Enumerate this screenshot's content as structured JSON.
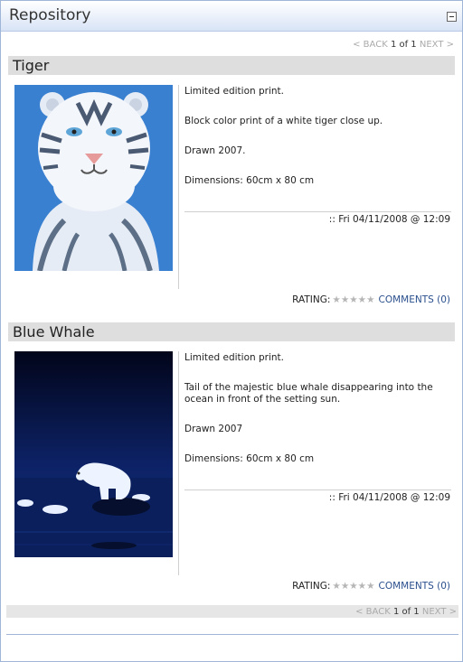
{
  "window": {
    "title": "Repository"
  },
  "pager": {
    "back": "< BACK",
    "page": "1 of 1",
    "next": "NEXT >"
  },
  "items": [
    {
      "title": "Tiger",
      "lines": [
        "Limited edition print.",
        "Block color print of a white tiger close up.",
        "Drawn 2007.",
        "Dimensions: 60cm x 80 cm"
      ],
      "date": ":: Fri 04/11/2008 @ 12:09",
      "rating_label": "RATING:",
      "stars": "★★★★★",
      "comments": "COMMENTS (0)"
    },
    {
      "title": "Blue Whale",
      "lines": [
        "Limited edition print.",
        "Tail of the majestic blue whale disappearing into the ocean in front of the setting sun.",
        "Drawn 2007",
        "Dimensions: 60cm x 80 cm"
      ],
      "date": ":: Fri 04/11/2008 @ 12:09",
      "rating_label": "RATING:",
      "stars": "★★★★★",
      "comments": "COMMENTS (0)"
    }
  ],
  "colors": {
    "accent": "#2a4f8d",
    "tiger_bg": "#3a80d0",
    "whale_bg": "#0b1a4a"
  }
}
